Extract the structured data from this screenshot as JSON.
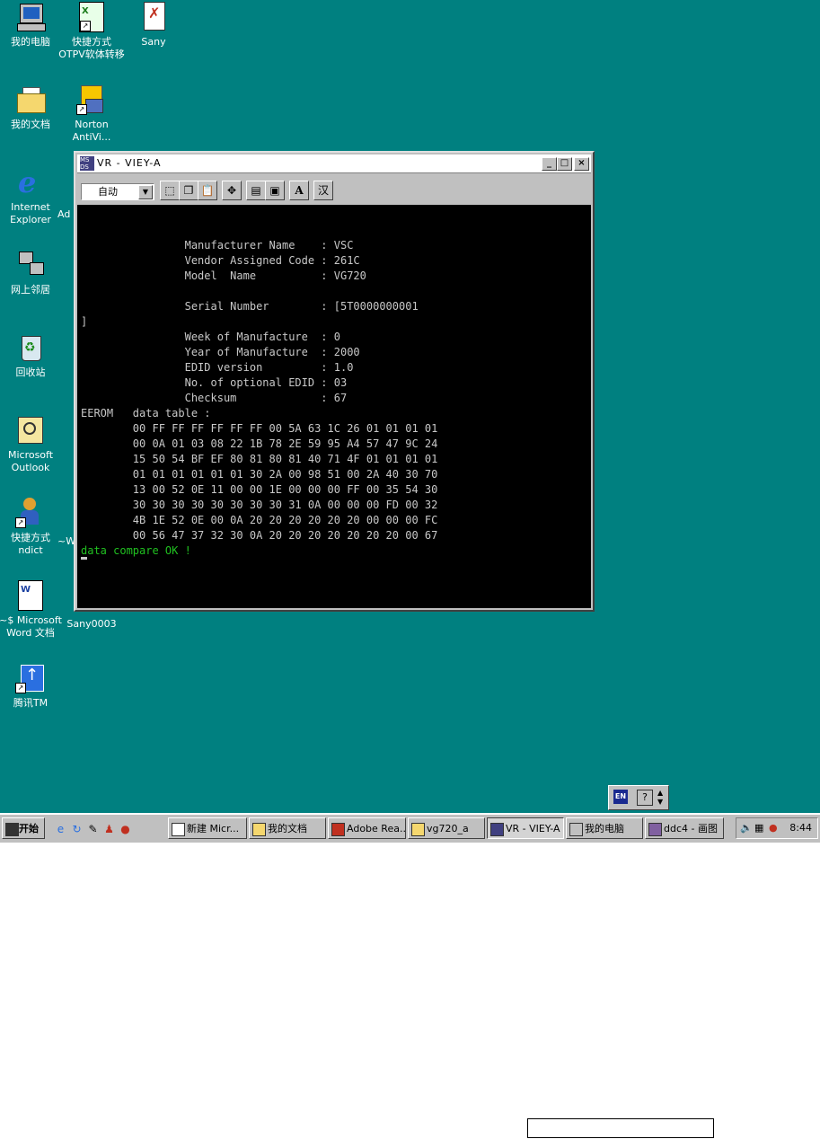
{
  "desktop": {
    "icons": [
      {
        "label": "我的电脑",
        "icon": "my-computer-icon"
      },
      {
        "label": "快捷方式\nOTPV软体转移",
        "icon": "excel-shortcut-icon"
      },
      {
        "label": "Sany",
        "icon": "sany-image-icon"
      },
      {
        "label": "我的文档",
        "icon": "my-documents-icon"
      },
      {
        "label": "Norton\nAntiVi...",
        "icon": "norton-antivirus-icon"
      },
      {
        "label": "Internet\nExplorer",
        "icon": "internet-explorer-icon"
      },
      {
        "label": "Ad",
        "icon": ""
      },
      {
        "label": "网上邻居",
        "icon": "network-neighborhood-icon"
      },
      {
        "label": "回收站",
        "icon": "recycle-bin-icon"
      },
      {
        "label": "Microsoft\nOutlook",
        "icon": "outlook-icon"
      },
      {
        "label": "快捷方式\nndict",
        "icon": "ndict-shortcut-icon"
      },
      {
        "label": "~W",
        "icon": ""
      },
      {
        "label": "~$ Microsoft\nWord 文档",
        "icon": "word-document-icon"
      },
      {
        "label": "Sany0003",
        "icon": ""
      },
      {
        "label": "腾讯TM",
        "icon": "tencent-tm-icon"
      }
    ]
  },
  "window": {
    "title": "VR - VIEY-A",
    "minimize": "_",
    "maximize": "□",
    "close": "×",
    "font_select": "自动",
    "tool_han": "汉",
    "tool_a": "A",
    "console_lines": [
      "",
      "                Manufacturer Name    : VSC",
      "                Vendor Assigned Code : 261C",
      "                Model  Name          : VG720",
      "",
      "                Serial Number        : [5T0000000001",
      "]",
      "                Week of Manufacture  : 0",
      "                Year of Manufacture  : 2000",
      "                EDID version         : 1.0",
      "                No. of optional EDID : 03",
      "                Checksum             : 67",
      "EEROM   data table :",
      "        00 FF FF FF FF FF FF 00 5A 63 1C 26 01 01 01 01",
      "        00 0A 01 03 08 22 1B 78 2E 59 95 A4 57 47 9C 24",
      "        15 50 54 BF EF 80 81 80 81 40 71 4F 01 01 01 01",
      "        01 01 01 01 01 01 30 2A 00 98 51 00 2A 40 30 70",
      "        13 00 52 0E 11 00 00 1E 00 00 00 FF 00 35 54 30",
      "        30 30 30 30 30 30 30 30 31 0A 00 00 00 FD 00 32",
      "        4B 1E 52 0E 00 0A 20 20 20 20 20 20 00 00 00 FC",
      "        00 56 47 37 32 30 0A 20 20 20 20 20 20 20 00 67"
    ],
    "ok_line": "data compare OK !"
  },
  "ime": {
    "lang": "EN",
    "help": "?"
  },
  "taskbar": {
    "start": "开始",
    "tasks": [
      {
        "label": "新建 Micr...",
        "icon": "word-task-icon"
      },
      {
        "label": "我的文档",
        "icon": "folder-task-icon"
      },
      {
        "label": "Adobe Rea...",
        "icon": "adobe-task-icon"
      },
      {
        "label": "vg720_a",
        "icon": "folder-task-icon"
      },
      {
        "label": "VR - VIEY-A",
        "icon": "vr-task-icon"
      },
      {
        "label": "我的电脑",
        "icon": "computer-task-icon"
      },
      {
        "label": "ddc4 - 画图",
        "icon": "paint-task-icon"
      }
    ],
    "clock": "8:44"
  },
  "colors": {
    "desktop": "#008080",
    "console_bg": "#000000",
    "console_text": "#c8c8c8",
    "ok_text": "#20c020"
  }
}
